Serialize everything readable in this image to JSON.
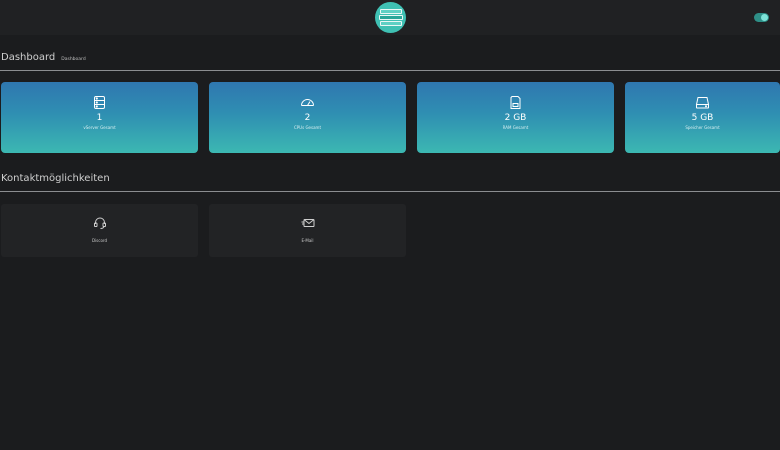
{
  "header": {
    "logo": {
      "line1": "",
      "line2": "",
      "line3": ""
    }
  },
  "dashboard": {
    "title": "Dashboard",
    "breadcrumb": "Dashboard",
    "cards": [
      {
        "icon": "server-icon",
        "value": "1",
        "label": "vServer Gesamt"
      },
      {
        "icon": "gauge-icon",
        "value": "2",
        "label": "CPUs Gesamt"
      },
      {
        "icon": "ram-icon",
        "value": "2 GB",
        "label": "RAM Gesamt"
      },
      {
        "icon": "hard-drive-icon",
        "value": "5 GB",
        "label": "Speicher Gesamt"
      }
    ]
  },
  "contact": {
    "title": "Kontaktmöglichkeiten",
    "cards": [
      {
        "icon": "headset-icon",
        "label": "Discord"
      },
      {
        "icon": "email-icon",
        "label": "E-Mail"
      }
    ]
  },
  "colors": {
    "background": "#1b1c1e",
    "topbar": "#202123",
    "card_gradient_top": "#2f77b0",
    "card_gradient_bottom": "#3cb8b2",
    "accent": "#3fc0b3"
  }
}
